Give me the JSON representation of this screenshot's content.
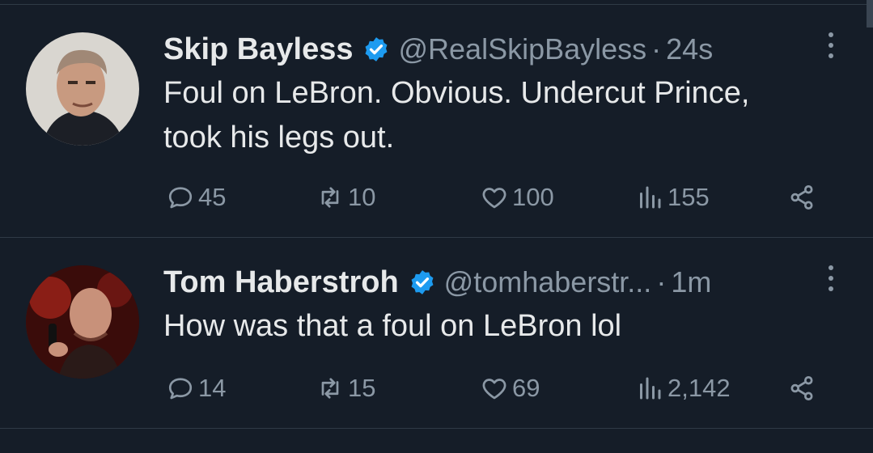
{
  "tweets": [
    {
      "name": "Skip Bayless",
      "handle": "@RealSkipBayless",
      "separator": "·",
      "time": "24s",
      "text_line1": "Foul on LeBron. Obvious. Undercut Prince,",
      "text_line2": "took his legs out.",
      "replies": "45",
      "retweets": "10",
      "likes": "100",
      "views": "155"
    },
    {
      "name": "Tom Haberstroh",
      "handle": "@tomhaberstr...",
      "separator": "·",
      "time": "1m",
      "text_line1": "How was that a foul on LeBron lol",
      "text_line2": "",
      "replies": "14",
      "retweets": "15",
      "likes": "69",
      "views": "2,142"
    }
  ],
  "icons": {
    "verified": "verified-badge-icon",
    "more": "more-options-icon",
    "reply": "reply-icon",
    "retweet": "retweet-icon",
    "like": "heart-icon",
    "views": "views-icon",
    "share": "share-icon"
  },
  "colors": {
    "background": "#151d28",
    "text": "#e7e9ea",
    "muted": "#8b98a5",
    "verified": "#1d9bf0",
    "divider": "#2f3a46"
  }
}
